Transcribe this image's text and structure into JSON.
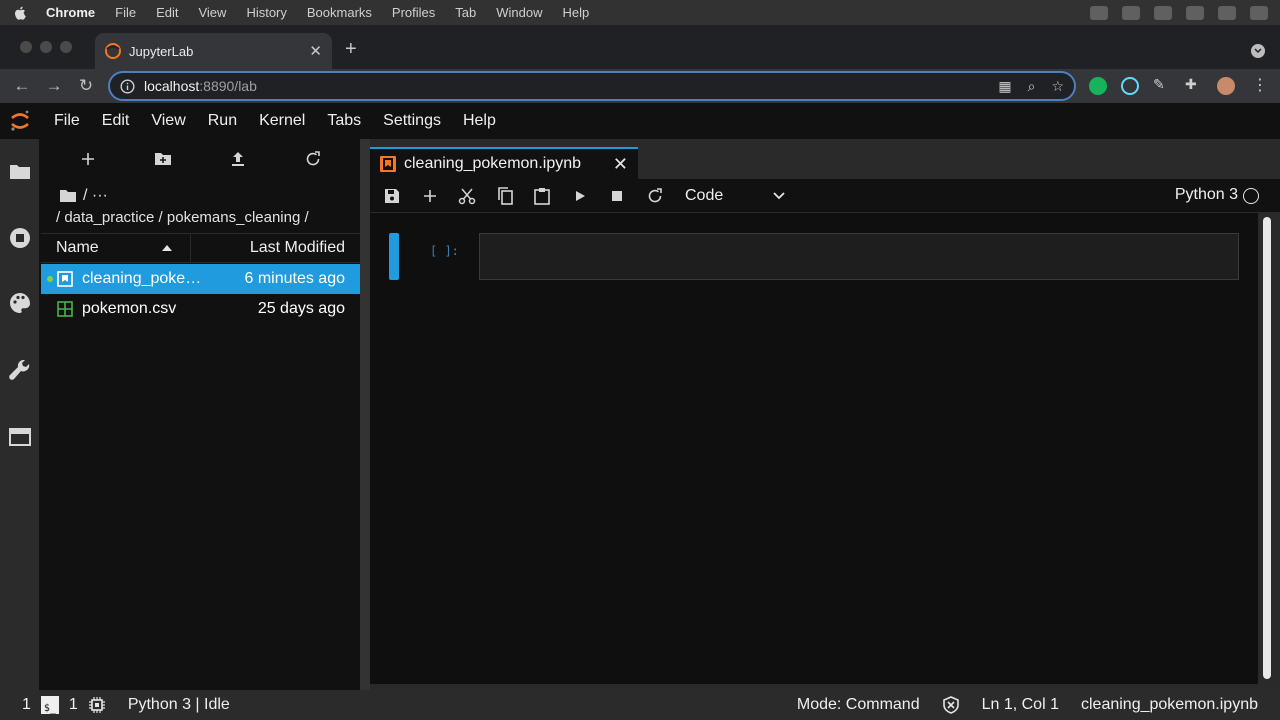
{
  "mac_menubar": {
    "app": "Chrome",
    "items": [
      "File",
      "Edit",
      "View",
      "History",
      "Bookmarks",
      "Profiles",
      "Tab",
      "Window",
      "Help"
    ]
  },
  "browser": {
    "tab_title": "JupyterLab",
    "url_host": "localhost",
    "url_rest": ":8890/lab"
  },
  "jupyter_menu": [
    "File",
    "Edit",
    "View",
    "Run",
    "Kernel",
    "Tabs",
    "Settings",
    "Help"
  ],
  "file_browser": {
    "breadcrumb_top": "/ ···",
    "breadcrumb_path": "/ data_practice / pokemans_cleaning /",
    "col_name": "Name",
    "col_modified": "Last Modified",
    "files": [
      {
        "name": "cleaning_pokemon.ipynb",
        "modified": "6 minutes ago",
        "type": "notebook",
        "selected": true,
        "running": true
      },
      {
        "name": "pokemon.csv",
        "modified": "25 days ago",
        "type": "csv",
        "selected": false,
        "running": false
      }
    ]
  },
  "notebook": {
    "tab_title": "cleaning_pokemon.ipynb",
    "cell_type": "Code",
    "kernel": "Python 3",
    "cell_prompt": "[ ]:"
  },
  "status": {
    "terminals": "1",
    "kernels": "1",
    "kernel_state": "Python 3 | Idle",
    "mode": "Mode: Command",
    "position": "Ln 1, Col 1",
    "file": "cleaning_pokemon.ipynb"
  },
  "colors": {
    "accent": "#1f9bde",
    "jupyter_orange": "#f37726",
    "csv_green": "#4caf50",
    "running_dot": "#7cd34a"
  }
}
